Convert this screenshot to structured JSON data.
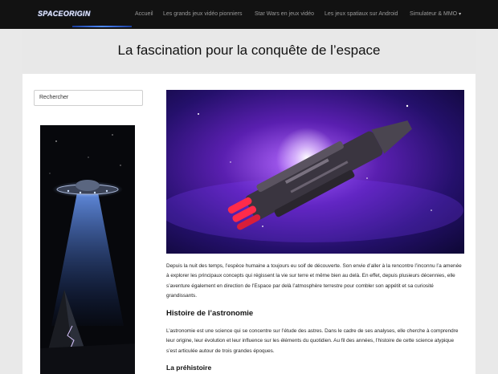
{
  "brand": {
    "logo_text": "SPACEORIGIN"
  },
  "nav": {
    "items": [
      {
        "label": "Accueil"
      },
      {
        "label": "Les grands jeux vidéo pionniers"
      },
      {
        "label": "Star Wars en jeux vidéo"
      },
      {
        "label": "Les jeux spatiaux sur Android"
      },
      {
        "label": "Simulateur & MMO"
      }
    ]
  },
  "hero": {
    "title": "La fascination pour la conquête de l’espace"
  },
  "sidebar": {
    "search_placeholder": "Rechercher"
  },
  "article": {
    "intro": "Depuis la nuit des temps, l’espèce humaine a toujours eu soif de découverte. Son envie d’aller à la rencontre l’inconnu l’a amenée à explorer les principaux concepts qui régissent la vie sur terre et même bien au delà. En effet, depuis plusieurs décennies, elle s’aventure également en direction de l’Espace par delà l’atmosphère terrestre pour combler son appétit et sa curiosité grandissants.",
    "heading_1": "Histoire de l’astronomie",
    "paragraph_1": "L’astronomie est une science qui se concentre sur l’étude des astres. Dans le cadre de ses analyses, elle cherche à comprendre leur origine, leur évolution et leur influence sur les éléments du quotidien. Au fil des années, l’histoire de cette science atypique s’est articulée autour de trois grandes époques.",
    "heading_2": "La préhistoire"
  },
  "colors": {
    "navbar": "#121212",
    "hero_bg": "#e8e8e8",
    "page_bg": "#ffffff",
    "accent": "#4f8bff"
  }
}
